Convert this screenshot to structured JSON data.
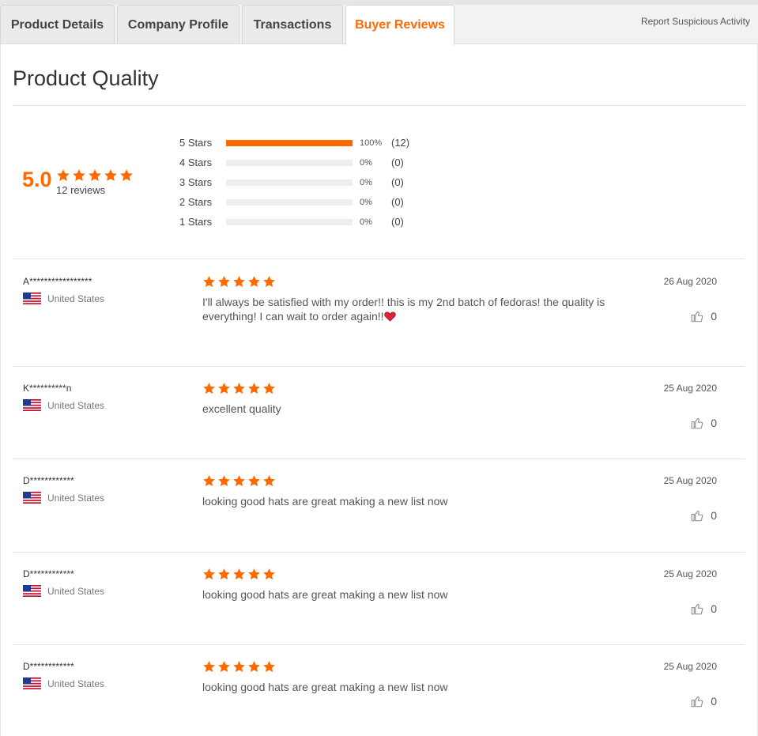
{
  "tabs": [
    {
      "label": "Product Details"
    },
    {
      "label": "Company Profile"
    },
    {
      "label": "Transactions"
    },
    {
      "label": "Buyer Reviews"
    }
  ],
  "report_link": "Report Suspicious Activity",
  "section_title": "Product Quality",
  "summary": {
    "average": "5.0",
    "stars": 5,
    "reviews_count": "12 reviews"
  },
  "distribution": [
    {
      "label": "5  Stars",
      "percent": "100%",
      "count": "(12)",
      "fraction": 1.0
    },
    {
      "label": "4  Stars",
      "percent": "0%",
      "count": "(0)",
      "fraction": 0
    },
    {
      "label": "3  Stars",
      "percent": "0%",
      "count": "(0)",
      "fraction": 0
    },
    {
      "label": "2  Stars",
      "percent": "0%",
      "count": "(0)",
      "fraction": 0
    },
    {
      "label": "1  Stars",
      "percent": "0%",
      "count": "(0)",
      "fraction": 0
    }
  ],
  "reviews": [
    {
      "name": "A*****************",
      "country": "United States",
      "rating": 5,
      "text": "I'll always be satisfied with my order!! this is my 2nd batch of fedoras! the quality is everything! I can wait to order again!!",
      "has_heart_emoji": true,
      "date": "26 Aug 2020",
      "likes": "0"
    },
    {
      "name": "K**********n",
      "country": "United States",
      "rating": 5,
      "text": "excellent quality",
      "has_heart_emoji": false,
      "date": "25 Aug 2020",
      "likes": "0"
    },
    {
      "name": "D************",
      "country": "United States",
      "rating": 5,
      "text": "looking good hats are great making a new list  now",
      "has_heart_emoji": false,
      "date": "25 Aug 2020",
      "likes": "0"
    },
    {
      "name": "D************",
      "country": "United States",
      "rating": 5,
      "text": "looking good hats are great making a new list  now",
      "has_heart_emoji": false,
      "date": "25 Aug 2020",
      "likes": "0"
    },
    {
      "name": "D************",
      "country": "United States",
      "rating": 5,
      "text": "looking good hats are great making a new list  now",
      "has_heart_emoji": false,
      "date": "25 Aug 2020",
      "likes": "0"
    }
  ],
  "colors": {
    "accent": "#ff6a00",
    "divider": "#e3e3e3",
    "bar_track": "#eeeeee"
  }
}
